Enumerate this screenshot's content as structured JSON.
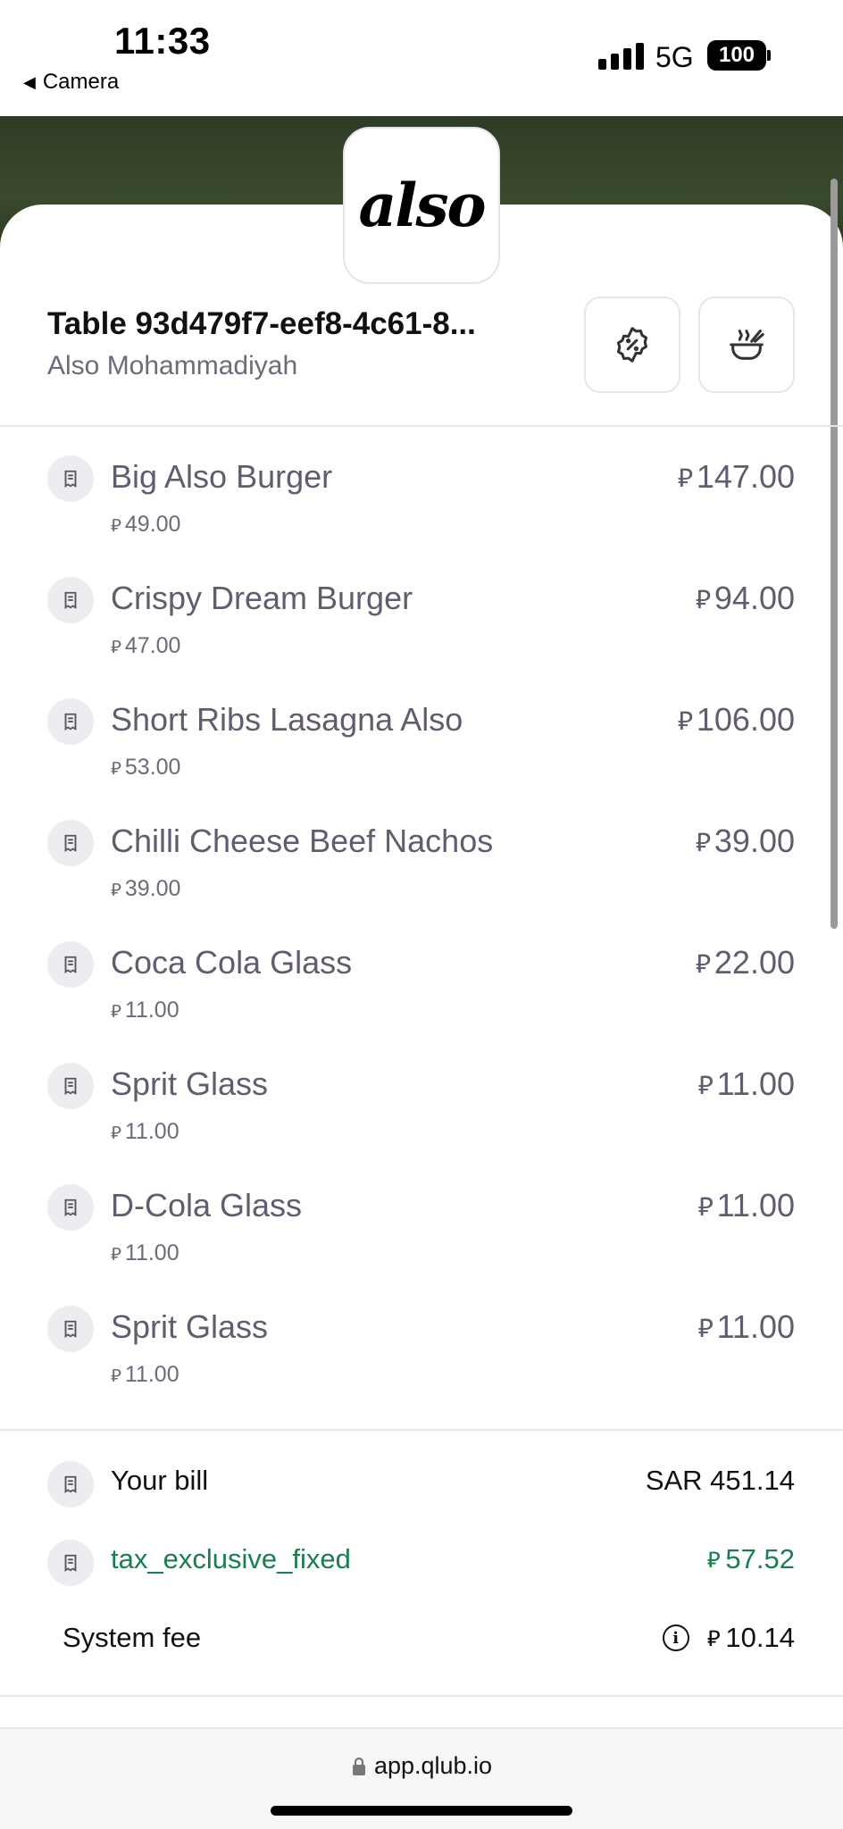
{
  "status_bar": {
    "time": "11:33",
    "back_app": "Camera",
    "network": "5G",
    "battery": "100"
  },
  "restaurant": {
    "logo_text": "also",
    "table_title": "Table 93d479f7-eef8-4c61-8...",
    "name": "Also Mohammadiyah"
  },
  "header_actions": {
    "discount_icon": "percent-badge-icon",
    "food_icon": "bowl-steam-icon"
  },
  "currency_symbol": "⃁",
  "items": [
    {
      "name": "Big Also Burger",
      "unit": "49.00",
      "total": "147.00"
    },
    {
      "name": "Crispy Dream Burger",
      "unit": "47.00",
      "total": "94.00"
    },
    {
      "name": "Short Ribs Lasagna Also",
      "unit": "53.00",
      "total": "106.00"
    },
    {
      "name": "Chilli Cheese Beef Nachos",
      "unit": "39.00",
      "total": "39.00"
    },
    {
      "name": "Coca Cola Glass",
      "unit": "11.00",
      "total": "22.00"
    },
    {
      "name": "Sprit Glass",
      "unit": "11.00",
      "total": "11.00"
    },
    {
      "name": "D-Cola Glass",
      "unit": "11.00",
      "total": "11.00"
    },
    {
      "name": "Sprit Glass",
      "unit": "11.00",
      "total": "11.00"
    }
  ],
  "summary": {
    "your_bill_label": "Your bill",
    "your_bill_value": "SAR 451.14",
    "tax_label": "tax_exclusive_fixed",
    "tax_value": "57.52",
    "system_fee_label": "System fee",
    "system_fee_value": "10.14"
  },
  "browser": {
    "url": "app.qlub.io"
  },
  "colors": {
    "accent_green": "#1a7f4e",
    "banner": "#2f3c25",
    "muted_text": "#5e5e70"
  }
}
